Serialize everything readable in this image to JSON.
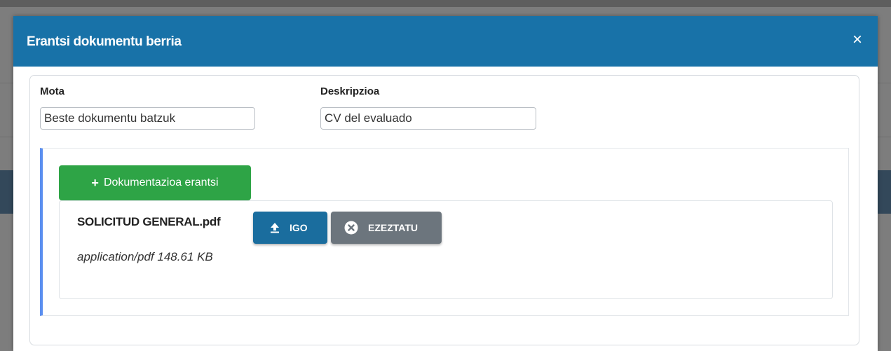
{
  "modal": {
    "title": "Erantsi dokumentu berria",
    "close_label": "×"
  },
  "form": {
    "type_label": "Mota",
    "type_value": "Beste dokumentu batzuk",
    "description_label": "Deskripzioa",
    "description_value": "CV del evaluado"
  },
  "attachments": {
    "add_button_label": "Dokumentazioa erantsi",
    "add_button_icon": "plus-icon",
    "file": {
      "name": "SOLICITUD GENERAL.pdf",
      "mime_type": "application/pdf",
      "size": "148.61 KB",
      "meta_text": "application/pdf  148.61 KB",
      "upload_label": "IGO",
      "upload_icon": "upload-icon",
      "cancel_label": "EZEZTATU",
      "cancel_icon": "cancel-circle-icon"
    }
  },
  "colors": {
    "header": "#1872a8",
    "add_button": "#2ea446",
    "upload_button": "#1a6d9e",
    "cancel_button": "#6c757d",
    "panel_accent": "#5b8ff0"
  }
}
